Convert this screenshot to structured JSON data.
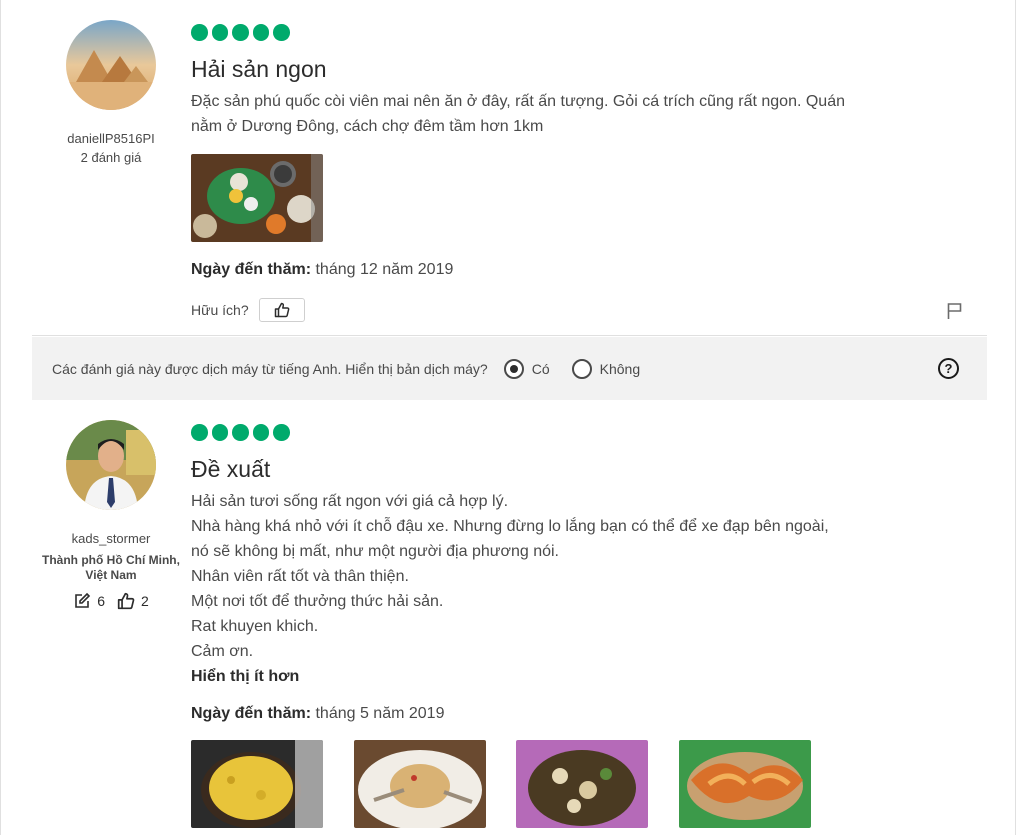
{
  "reviews": [
    {
      "username": "daniellP8516PI",
      "review_count": "2 đánh giá",
      "rating": 5,
      "title": "Hải sản ngon",
      "body": [
        "Đặc sản phú quốc còi viên mai nên ăn ở đây, rất ấn tượng. Gỏi cá trích cũng rất ngon. Quán",
        "nằm ở Dương Đông, cách chợ đêm tầm hơn 1km"
      ],
      "visit_label": "Ngày đến thăm:",
      "visit_date": "tháng 12 năm 2019",
      "helpful_label": "Hữu ích?"
    },
    {
      "username": "kads_stormer",
      "location": "Thành phố Hồ Chí Minh, Việt Nam",
      "contributions": "6",
      "helpful_votes": "2",
      "rating": 5,
      "title": "Đề xuất",
      "body": [
        "Hải sản tươi sống rất ngon với giá cả hợp lý.",
        "Nhà hàng khá nhỏ với ít chỗ đậu xe. Nhưng đừng lo lắng bạn có thể để xe đạp bên ngoài,",
        "nó sẽ không bị mất, như một người địa phương nói.",
        "Nhân viên rất tốt và thân thiện.",
        "Một nơi tốt để thưởng thức hải sản.",
        "Rat khuyen khich.",
        "Cảm ơn."
      ],
      "show_less": "Hiển thị ít hơn",
      "visit_label": "Ngày đến thăm:",
      "visit_date": "tháng 5 năm 2019"
    }
  ],
  "translate_bar": {
    "question": "Các đánh giá này được dịch máy từ tiếng Anh. Hiển thị bản dịch máy?",
    "yes": "Có",
    "no": "Không",
    "selected": "yes",
    "help_symbol": "?"
  },
  "colors": {
    "bubble": "#00aa6c",
    "bar_bg": "#f2f2f2"
  }
}
